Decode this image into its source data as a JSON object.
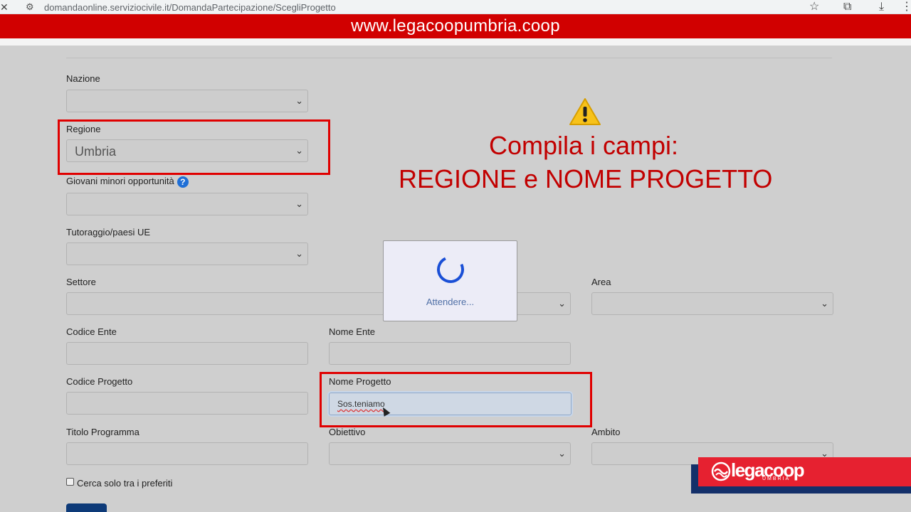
{
  "browser": {
    "url": "domandaonline.serviziocivile.it/DomandaPartecipazione/ScegliProgetto",
    "icons": [
      "close-icon",
      "site-info-icon",
      "star-icon",
      "extensions-icon",
      "download-icon",
      "more-icon"
    ]
  },
  "banner": {
    "text": "www.legacoopumbria.coop",
    "color": "#d10000"
  },
  "form": {
    "nazione": {
      "label": "Nazione",
      "value": ""
    },
    "regione": {
      "label": "Regione",
      "value": "Umbria"
    },
    "giovani": {
      "label": "Giovani minori opportunità",
      "help": "?",
      "value": ""
    },
    "tutoraggio": {
      "label": "Tutoraggio/paesi UE",
      "value": ""
    },
    "settore": {
      "label": "Settore",
      "value": ""
    },
    "area": {
      "label": "Area",
      "value": ""
    },
    "codice_ente": {
      "label": "Codice Ente",
      "value": ""
    },
    "nome_ente": {
      "label": "Nome Ente",
      "value": ""
    },
    "codice_progetto": {
      "label": "Codice Progetto",
      "value": ""
    },
    "nome_progetto": {
      "label": "Nome Progetto",
      "value": "Sos.teniamo"
    },
    "titolo_programma": {
      "label": "Titolo Programma",
      "value": ""
    },
    "obiettivo": {
      "label": "Obiettivo",
      "value": ""
    },
    "ambito": {
      "label": "Ambito",
      "value": ""
    },
    "preferiti": {
      "label": "Cerca solo tra i preferiti",
      "checked": false
    }
  },
  "instruction": {
    "line1": "Compila i campi:",
    "line2": "REGIONE e NOME PROGETTO",
    "icon": "warning-icon",
    "color": "#c20000"
  },
  "loading": {
    "text": "Attendere..."
  },
  "logo": {
    "name": "legacoop",
    "sub": "UMBRIA",
    "color": "#e62130"
  }
}
